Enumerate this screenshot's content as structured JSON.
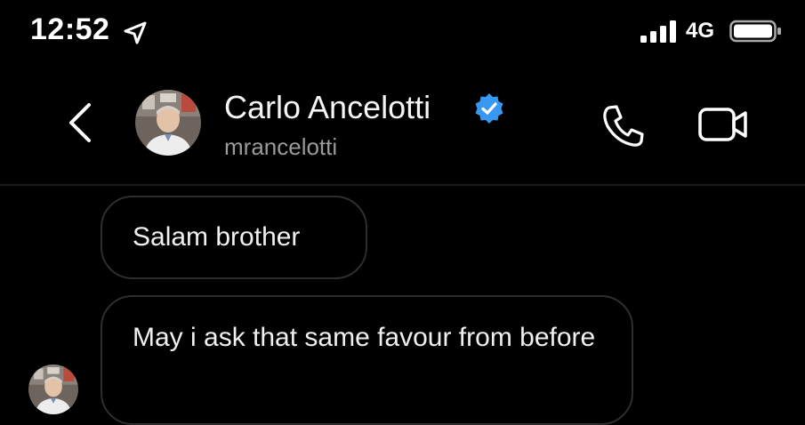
{
  "status_bar": {
    "time": "12:52",
    "network": "4G",
    "icons": [
      "location-arrow-icon",
      "signal-bars-icon",
      "battery-icon"
    ]
  },
  "header": {
    "name": "Carlo Ancelotti",
    "username": "mrancelotti",
    "verified_color": "#3897f0",
    "icons": [
      "back-chevron-icon",
      "verified-badge-icon",
      "phone-call-icon",
      "video-call-icon"
    ]
  },
  "messages": [
    {
      "text": "Salam brother"
    },
    {
      "text": "May i ask that same favour from before"
    }
  ],
  "colors": {
    "background": "#000000",
    "bubble_border": "#2e2e2e",
    "muted_text": "#9a9a9a"
  }
}
